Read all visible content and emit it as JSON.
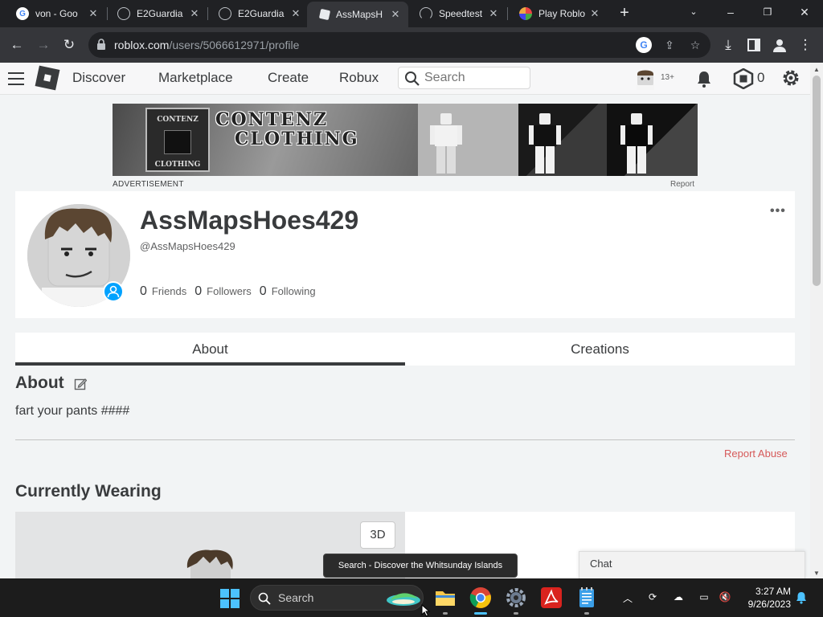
{
  "browser": {
    "tabs": [
      {
        "title": "von - Goo",
        "favicon": "google-icon"
      },
      {
        "title": "E2Guardia",
        "favicon": "globe-icon"
      },
      {
        "title": "E2Guardia",
        "favicon": "globe-icon"
      },
      {
        "title": "AssMapsH",
        "favicon": "roblox-icon",
        "active": true
      },
      {
        "title": "Speedtest",
        "favicon": "speedtest-icon"
      },
      {
        "title": "Play Roblo",
        "favicon": "roblox-play-icon"
      }
    ],
    "url_host": "roblox.com",
    "url_path": "/users/5066612971/profile"
  },
  "nav": {
    "links": [
      "Discover",
      "Marketplace",
      "Create",
      "Robux"
    ],
    "search_placeholder": "Search",
    "age_label": "13+",
    "robux_count": "0"
  },
  "ad": {
    "logo_text_top": "CONTENZ",
    "logo_text_bottom": "CLOTHING",
    "line1": "CONTENZ",
    "line2": "CLOTHING",
    "label": "ADVERTISEMENT",
    "report": "Report"
  },
  "profile": {
    "display_name": "AssMapsHoes429",
    "handle": "@AssMapsHoes429",
    "stats": [
      {
        "value": "0",
        "label": "Friends"
      },
      {
        "value": "0",
        "label": "Followers"
      },
      {
        "value": "0",
        "label": "Following"
      }
    ]
  },
  "tabs": {
    "about": "About",
    "creations": "Creations"
  },
  "about": {
    "title": "About",
    "text": "fart your pants ####",
    "report_abuse": "Report Abuse"
  },
  "wearing": {
    "title": "Currently Wearing",
    "btn_3d": "3D"
  },
  "chat": {
    "label": "Chat"
  },
  "taskbar": {
    "search_label": "Search",
    "tooltip": "Search - Discover the Whitsunday Islands",
    "time": "3:27 AM",
    "date": "9/26/2023"
  },
  "colors": {
    "accent": "#00a2ff",
    "report": "#d65a5a",
    "text": "#393b3d"
  }
}
